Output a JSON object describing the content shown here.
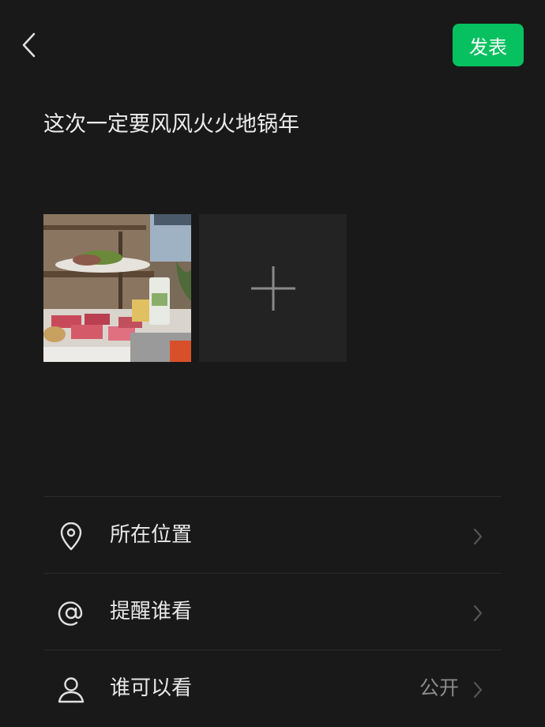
{
  "header": {
    "publish_label": "发表"
  },
  "post": {
    "text": "这次一定要风风火火地锅年"
  },
  "photos": [
    {
      "description_icon": "hotpot-photo"
    }
  ],
  "add_photo_icon": "plus-icon",
  "menu": [
    {
      "label": "所在位置",
      "icon": "location-pin-icon",
      "value": ""
    },
    {
      "label": "提醒谁看",
      "icon": "at-sign-icon",
      "value": ""
    },
    {
      "label": "谁可以看",
      "icon": "person-icon",
      "value": "公开"
    }
  ],
  "colors": {
    "background": "#191919",
    "accent": "#07c160",
    "divider": "#2b2b2b",
    "secondary_text": "#8c8c8c"
  }
}
